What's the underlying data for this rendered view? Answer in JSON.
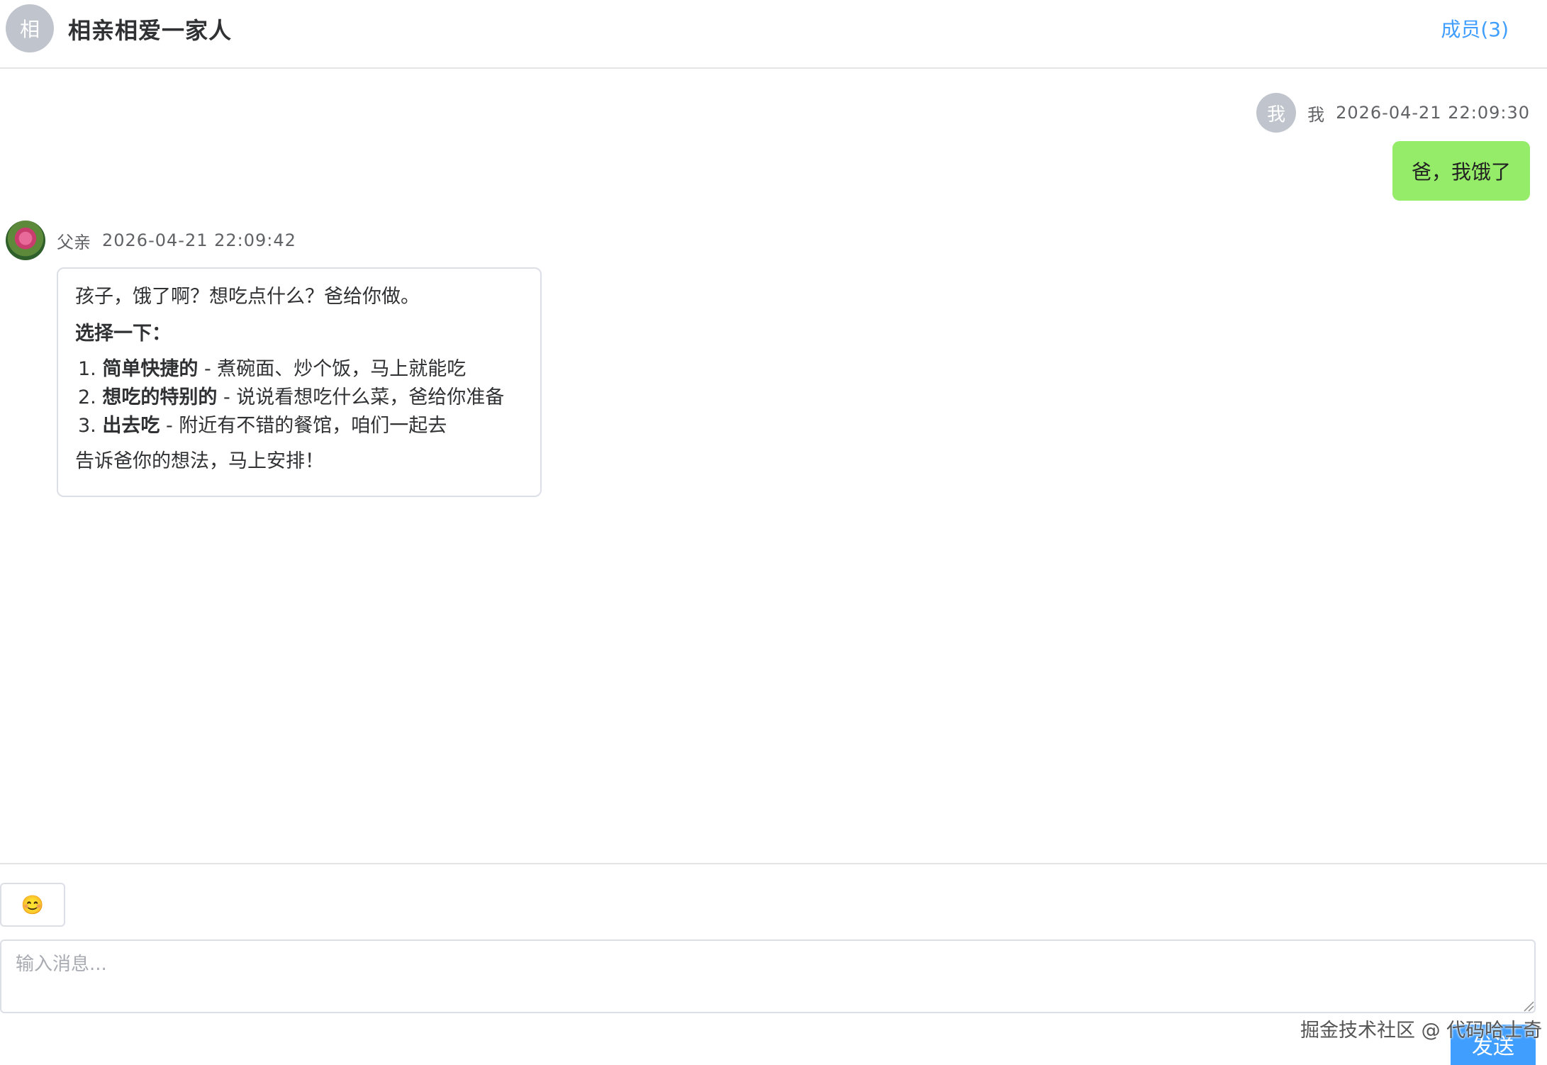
{
  "header": {
    "group_avatar_text": "相",
    "title": "相亲相爱一家人",
    "members_link": "成员(3)"
  },
  "messages": {
    "self": {
      "avatar_text": "我",
      "name": "我",
      "time": "2026-04-21 22:09:30",
      "text": "爸，我饿了"
    },
    "other": {
      "name": "父亲",
      "time": "2026-04-21 22:09:42",
      "intro": "孩子，饿了啊？想吃点什么？爸给你做。",
      "prompt": "选择一下：",
      "options": [
        {
          "num": "1.",
          "bold": "简单快捷的",
          "rest": " - 煮碗面、炒个饭，马上就能吃"
        },
        {
          "num": "2.",
          "bold": "想吃的特别的",
          "rest": " - 说说看想吃什么菜，爸给你准备"
        },
        {
          "num": "3.",
          "bold": "出去吃",
          "rest": " - 附近有不错的餐馆，咱们一起去"
        }
      ],
      "closing": "告诉爸你的想法，马上安排！"
    }
  },
  "composer": {
    "emoji": "😊",
    "placeholder": "输入消息...",
    "send_label": "发送"
  },
  "watermark": "掘金技术社区 @ 代码哈士奇",
  "colors": {
    "accent": "#409eff",
    "self_bubble": "#95ec69",
    "avatar_gray": "#c0c4cc"
  }
}
